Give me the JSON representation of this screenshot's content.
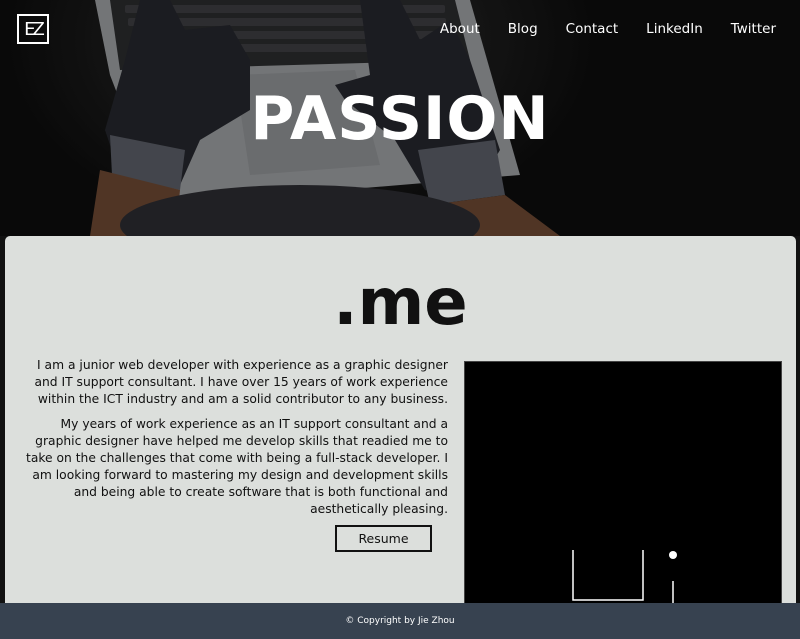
{
  "header": {
    "logo_text": "EZ",
    "nav": [
      {
        "label": "About"
      },
      {
        "label": "Blog"
      },
      {
        "label": "Contact"
      },
      {
        "label": "LinkedIn"
      },
      {
        "label": "Twitter"
      }
    ],
    "hero_title": "PASSION"
  },
  "main": {
    "title": ".me",
    "paragraphs": [
      "I am a junior web developer with experience as a graphic designer and IT support consultant. I have over 15 years of work experience within the ICT industry and am a solid contributor to any business.",
      "My years of work experience as an IT support consultant and a graphic designer have helped me develop skills that readied me to take on the challenges that come with being a full-stack developer. I am looking forward to mastering my design and development skills and being able to create software that is both functional and aesthetically pleasing."
    ],
    "resume_label": "Resume"
  },
  "footer": {
    "copyright": "© Copyright by Jie Zhou"
  },
  "colors": {
    "panel_bg": "#dcdfdc",
    "footer_bg": "#374250",
    "text": "#111111"
  }
}
